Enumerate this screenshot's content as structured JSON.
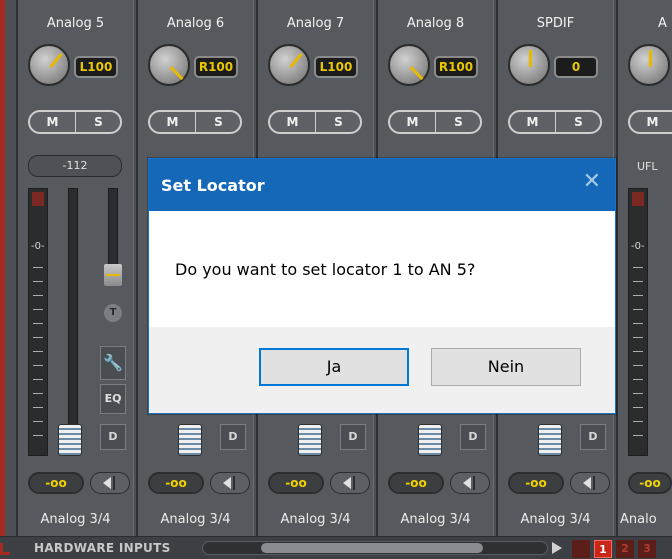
{
  "channels": [
    {
      "name": "Analog 5",
      "pan": "L100",
      "mute": "M",
      "solo": "S",
      "gain": "-oo",
      "output": "Analog 3/4",
      "peak": "-112"
    },
    {
      "name": "Analog 6",
      "pan": "R100",
      "mute": "M",
      "solo": "S",
      "gain": "-oo",
      "output": "Analog 3/4"
    },
    {
      "name": "Analog 7",
      "pan": "L100",
      "mute": "M",
      "solo": "S",
      "gain": "-oo",
      "output": "Analog 3/4"
    },
    {
      "name": "Analog 8",
      "pan": "R100",
      "mute": "M",
      "solo": "S",
      "gain": "-oo",
      "output": "Analog 3/4"
    },
    {
      "name": "SPDIF",
      "pan": "0",
      "mute": "M",
      "solo": "S",
      "gain": "-oo",
      "output": "Analog 3/4"
    },
    {
      "name": "A",
      "mute": "M",
      "gain": "-oo",
      "output": "Analo",
      "peak": "UFL"
    }
  ],
  "meter_zero_label": "-0-",
  "channel1_buttons": {
    "trim": "T",
    "wrench": "🔧",
    "eq": "EQ"
  },
  "d_label": "D",
  "bottombar": {
    "label": "HARDWARE INPUTS",
    "pages": [
      "",
      "1",
      "2",
      "3"
    ]
  },
  "dialog": {
    "title": "Set Locator",
    "close_glyph": "✕",
    "message": "Do you want to set locator 1 to AN 5?",
    "yes": "Ja",
    "no": "Nein"
  }
}
